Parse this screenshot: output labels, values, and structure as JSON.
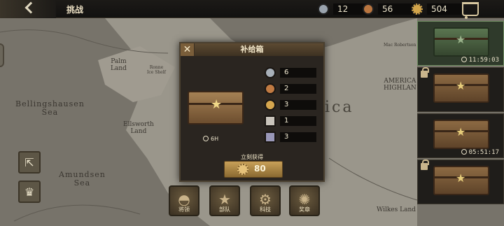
{
  "header": {
    "title": "挑战",
    "resources": [
      {
        "icon": "silver-medal-icon",
        "value": "12",
        "color": "#9aa3ad"
      },
      {
        "icon": "bronze-medal-icon",
        "value": "56",
        "color": "#b9753f"
      },
      {
        "icon": "gear-medal-icon",
        "value": "504",
        "color": "#d2a44a"
      }
    ],
    "shop_icon": "cart-icon"
  },
  "map_labels": {
    "bellingshausen": "Bellingshausen",
    "bellingshausen_sea": "Sea",
    "amundsen": "Amundsen",
    "amundsen_sea": "Sea",
    "palmer": "Palm",
    "palmer_land": "Land",
    "ronne": "Ronne",
    "ronne_shelf": "Ice Shelf",
    "ellsworth": "Ellsworth",
    "ellsworth_land": "Land",
    "america": "AMERICA",
    "highland": "HIGHLAN",
    "antarctica": "ica",
    "robertson": "Mac Robertson",
    "wilkes": "Wilkes Land"
  },
  "side_buttons": [
    {
      "icon": "share-icon"
    },
    {
      "icon": "trophy-icon"
    }
  ],
  "bottom_nav": [
    {
      "label": "将领",
      "icon": "officer-cap-icon"
    },
    {
      "label": "部队",
      "icon": "unit-badge-icon"
    },
    {
      "label": "科技",
      "icon": "tech-gear-icon"
    },
    {
      "label": "奖章",
      "icon": "medal-icon"
    }
  ],
  "chest_slots": [
    {
      "timer": "11:59:03",
      "locked": false,
      "active": true
    },
    {
      "timer": "",
      "locked": true,
      "active": false
    },
    {
      "timer": "05:51:17",
      "locked": false,
      "active": false
    },
    {
      "timer": "",
      "locked": true,
      "active": false
    }
  ],
  "modal": {
    "title": "补给箱",
    "close_glyph": "✕",
    "time": "6H",
    "rewards": [
      {
        "icon": "silver-medal-icon",
        "value": "6",
        "color": "#a8b0b8"
      },
      {
        "icon": "bronze-medal-icon",
        "value": "2",
        "color": "#c07a42"
      },
      {
        "icon": "star-medal-icon",
        "value": "3",
        "color": "#d6a64e"
      },
      {
        "icon": "officer-card-icon",
        "value": "1",
        "color": "#c9c4bb"
      },
      {
        "icon": "officer-card-icon",
        "value": "3",
        "color": "#9a98b8"
      }
    ],
    "buy_caption": "立刻获得",
    "price": "80"
  }
}
